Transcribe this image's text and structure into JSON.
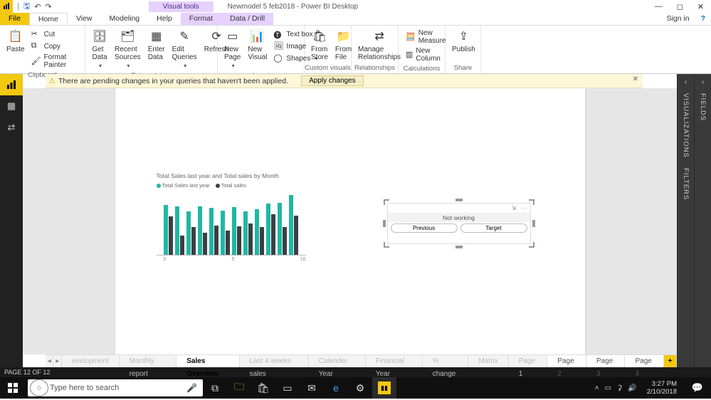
{
  "app": {
    "title": "Newmodel 5 feb2018 - Power BI Desktop",
    "visual_tools_label": "Visual tools",
    "sign_in": "Sign in"
  },
  "ribbon_tabs": {
    "file": "File",
    "home": "Home",
    "view": "View",
    "modeling": "Modeling",
    "help": "Help",
    "format": "Format",
    "datadrill": "Data / Drill"
  },
  "ribbon": {
    "paste": "Paste",
    "cut": "Cut",
    "copy": "Copy",
    "format_painter": "Format Painter",
    "clipboard": "Clipboard",
    "get_data": "Get\nData",
    "recent_sources": "Recent\nSources",
    "enter_data": "Enter\nData",
    "edit_queries": "Edit\nQueries",
    "refresh": "Refresh",
    "external_data": "External data",
    "new_page": "New\nPage",
    "new_visual": "New\nVisual",
    "text_box": "Text box",
    "image": "Image",
    "shapes": "Shapes",
    "insert": "Insert",
    "from_store": "From\nStore",
    "from_file": "From\nFile",
    "custom_visuals": "Custom visuals",
    "manage_rel": "Manage\nRelationships",
    "relationships": "Relationships",
    "new_measure": "New Measure",
    "new_column": "New Column",
    "calculations": "Calculations",
    "publish": "Publish",
    "share": "Share"
  },
  "warning": {
    "text": "There are pending changes in your queries that haven't been applied.",
    "apply": "Apply changes"
  },
  "chart_data": {
    "type": "bar",
    "title": "Total Sales last year and Total sales by Month",
    "xlabel": "",
    "ylabel": "",
    "x_ticks": [
      "0",
      "5",
      "10"
    ],
    "series": [
      {
        "name": "Total Sales last year",
        "color": "#1fb8a3",
        "values": [
          72,
          70,
          62,
          70,
          68,
          64,
          69,
          62,
          66,
          74,
          75,
          86
        ]
      },
      {
        "name": "Total sales",
        "color": "#3b3f45",
        "values": [
          55,
          28,
          40,
          32,
          42,
          35,
          41,
          45,
          40,
          58,
          40,
          56
        ]
      }
    ]
  },
  "slicer": {
    "title": "Not working",
    "option_a": "Previous",
    "option_b": "Target"
  },
  "right_panels": {
    "viz": "VISUALIZATIONS",
    "filters": "FILTERS",
    "fields": "FIELDS"
  },
  "page_tabs": {
    "hidden": [
      "evelopment",
      "Monthly report"
    ],
    "active": "Sales Overview",
    "rest": [
      "Last 4 weeks sales",
      "Calender Year",
      "Financial Year",
      "% change",
      "Matrix",
      "Page 1"
    ],
    "more": [
      "Page 2",
      "Page 3",
      "Page 4"
    ]
  },
  "status": "PAGE 12 OF 12",
  "taskbar": {
    "search_placeholder": "Type here to search",
    "time": "3:27 PM",
    "date": "2/10/2018"
  }
}
